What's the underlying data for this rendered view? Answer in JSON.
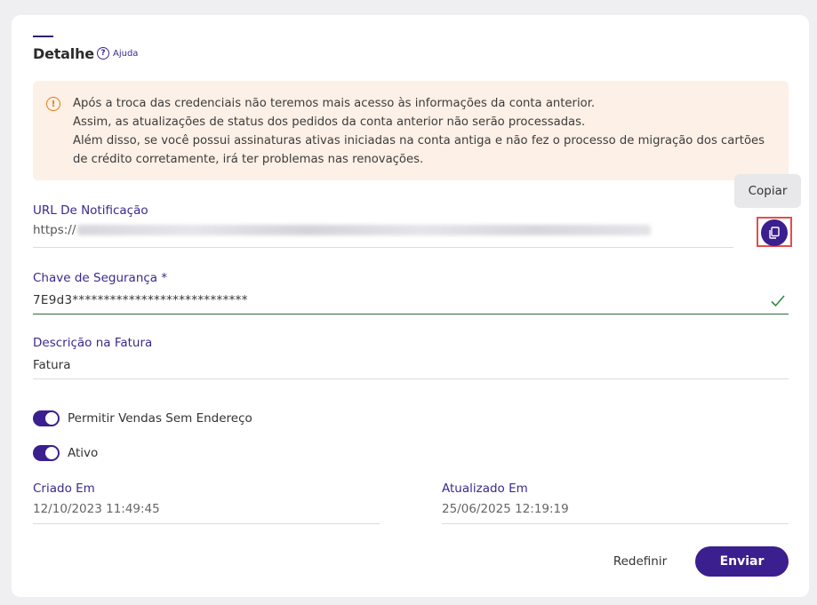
{
  "header": {
    "title": "Detalhe",
    "help_label": "Ajuda",
    "help_icon": "question-circle-icon"
  },
  "alert": {
    "icon": "warning-circle-icon",
    "lines": [
      "Após a troca das credenciais não teremos mais acesso às informações da conta anterior.",
      "Assim, as atualizações de status dos pedidos da conta anterior não serão processadas.",
      "Além disso, se você possui assinaturas ativas iniciadas na conta antiga e não fez o processo de migração dos cartões",
      "de crédito corretamente, irá ter problemas nas renovações."
    ]
  },
  "notification_url": {
    "label": "URL De Notificação",
    "value_prefix": "https://",
    "copy_tooltip": "Copiar",
    "copy_icon": "copy-icon"
  },
  "security_key": {
    "label": "Chave de Segurança *",
    "value": "7E9d3****************************",
    "valid_icon": "check-icon"
  },
  "invoice_description": {
    "label": "Descrição na Fatura",
    "value": "Fatura"
  },
  "toggles": [
    {
      "label": "Permitir Vendas Sem Endereço",
      "on": true
    },
    {
      "label": "Ativo",
      "on": true
    }
  ],
  "created": {
    "label": "Criado Em",
    "value": "12/10/2023 11:49:45"
  },
  "updated": {
    "label": "Atualizado Em",
    "value": "25/06/2025 12:19:19"
  },
  "actions": {
    "reset_label": "Redefinir",
    "submit_label": "Enviar"
  },
  "colors": {
    "primary": "#3b1f8e",
    "alert_bg": "#fdf0e6",
    "alert_icon": "#e07a10",
    "success": "#2e8b3c",
    "highlight": "#e74c4c"
  }
}
